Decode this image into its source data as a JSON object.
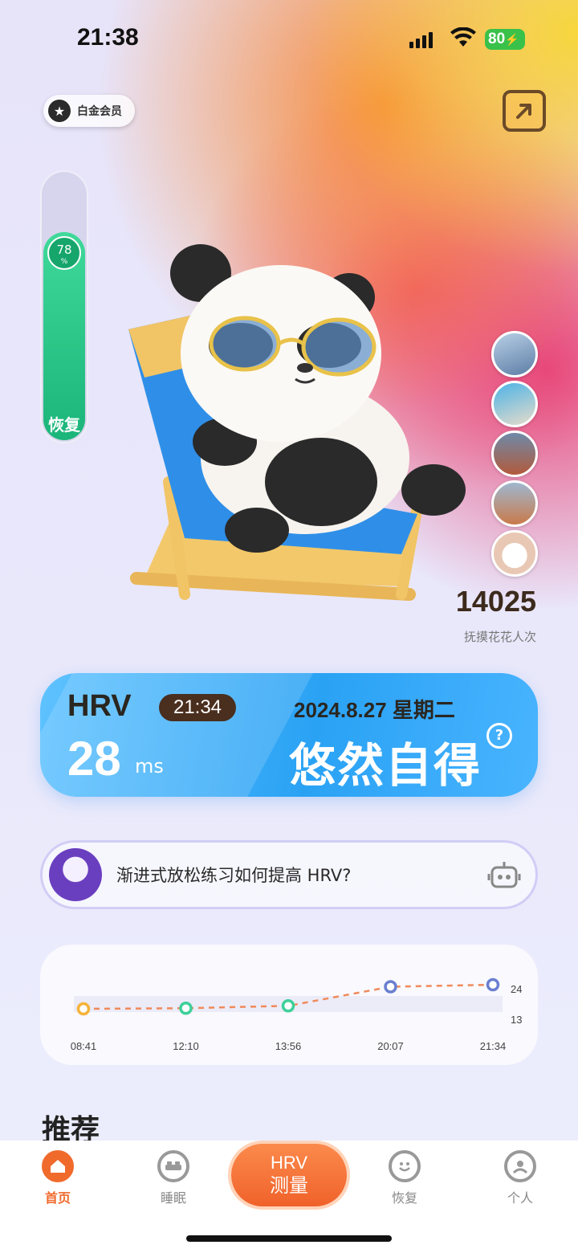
{
  "status_bar": {
    "time": "21:38",
    "battery": "80"
  },
  "member_badge": {
    "label": "白金会员"
  },
  "recovery_gauge": {
    "value": "78",
    "unit": "%",
    "label": "恢复",
    "fill_fraction": 0.78
  },
  "pet": {
    "count": "14025",
    "count_label": "抚摸花花人次"
  },
  "hrv_card": {
    "title": "HRV",
    "time": "21:34",
    "value": "28",
    "unit": "ms",
    "date": "2024.8.27 星期二",
    "status": "悠然自得",
    "help": "?"
  },
  "ai_prompt": {
    "text": "渐进式放松练习如何提高 HRV?"
  },
  "chart_data": {
    "type": "line",
    "x": [
      "08:41",
      "12:10",
      "13:56",
      "20:07",
      "21:34"
    ],
    "series": [
      {
        "values": [
          12,
          12.3,
          13.5,
          23,
          24
        ],
        "point_colors": [
          "#f5b33b",
          "#3ed09a",
          "#3ed09a",
          "#6a7fd0",
          "#6a7fd0"
        ]
      }
    ],
    "y_ticks": [
      "24",
      "13"
    ],
    "line_color": "#f08a5a"
  },
  "section": {
    "title": "推荐"
  },
  "tabbar": {
    "tabs": [
      {
        "label": "首页",
        "icon": "home-icon",
        "active": true
      },
      {
        "label": "睡眠",
        "icon": "bed-icon"
      },
      {
        "label": "恢复",
        "icon": "smile-icon"
      },
      {
        "label": "个人",
        "icon": "user-icon"
      }
    ],
    "measure": {
      "line1": "HRV",
      "line2": "测量"
    }
  },
  "colors": {
    "accent": "#f06a2c",
    "hrv_blue": "#2aa2f4",
    "recovery_green": "#1bb57a"
  }
}
